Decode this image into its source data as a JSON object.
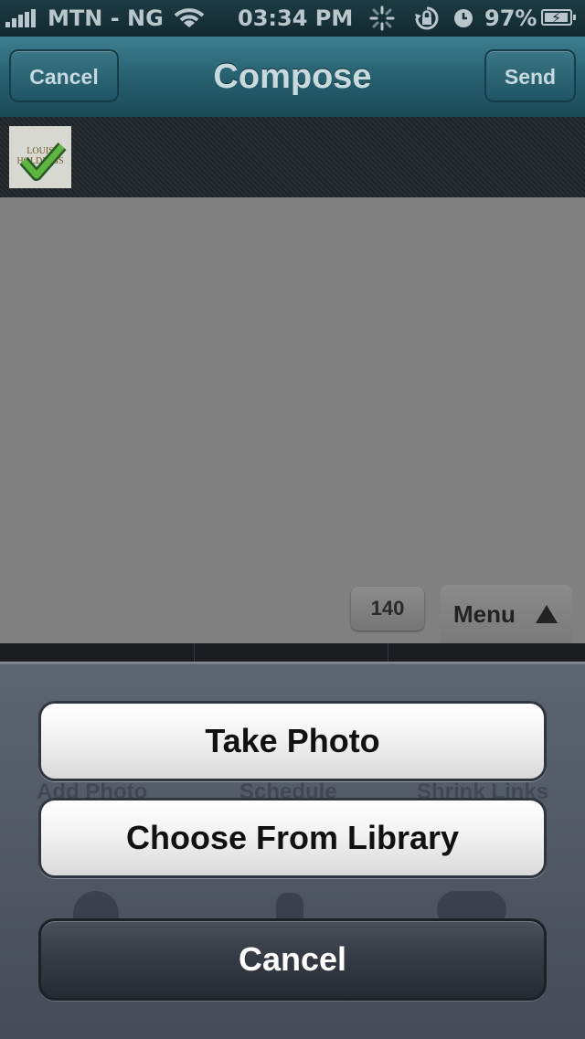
{
  "status_bar": {
    "carrier": "MTN - NG",
    "time": "03:34 PM",
    "battery": "97%",
    "battery_level": 0.97,
    "icons": [
      "signal-icon",
      "wifi-icon",
      "activity-spinner-icon",
      "orientation-lock-icon",
      "alarm-clock-icon",
      "battery-charging-icon"
    ]
  },
  "nav": {
    "title": "Compose",
    "cancel_label": "Cancel",
    "send_label": "Send"
  },
  "attachment": {
    "thumbnail_text": "LOUIS HOLDINGS",
    "selected": true
  },
  "compose": {
    "char_counter": "140",
    "menu_label": "Menu"
  },
  "toolbar_behind": {
    "items": [
      "Add Photo",
      "Schedule",
      "Shrink Links"
    ]
  },
  "action_sheet": {
    "take_photo": "Take Photo",
    "choose_library": "Choose From Library",
    "cancel": "Cancel"
  },
  "colors": {
    "nav_bar": "#27606f",
    "compose_bg": "#808080",
    "sheet_bg": "#545b67"
  }
}
